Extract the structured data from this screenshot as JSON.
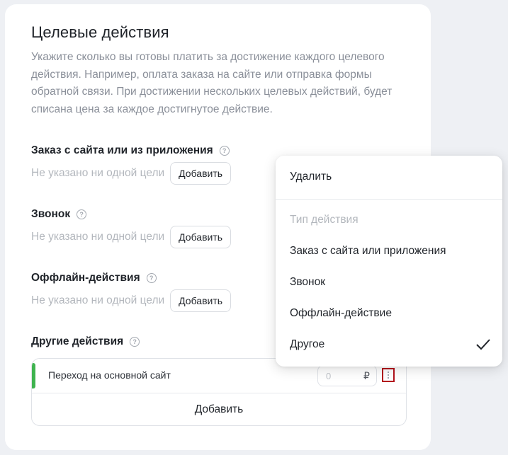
{
  "page": {
    "title": "Целевые действия",
    "description": "Укажите сколько вы готовы платить за достижение каждого целевого действия. Например, оплата заказа на сайте или отправка формы обратной связи. При достижении нескольких целевых действий, будет списана цена за каждое достигнутое действие."
  },
  "sections": [
    {
      "title": "Заказ с сайта или из приложения",
      "empty_text": "Не указано ни одной цели",
      "add_label": "Добавить"
    },
    {
      "title": "Звонок",
      "empty_text": "Не указано ни одной цели",
      "add_label": "Добавить"
    },
    {
      "title": "Оффлайн-действия",
      "empty_text": "Не указано ни одной цели",
      "add_label": "Добавить"
    },
    {
      "title": "Другие действия"
    }
  ],
  "other_goals": {
    "items": [
      {
        "name": "Переход на основной сайт",
        "price_placeholder": "0",
        "currency": "₽",
        "status_color": "#3fb34f"
      }
    ],
    "add_label": "Добавить"
  },
  "context_menu": {
    "delete_label": "Удалить",
    "type_label": "Тип действия",
    "options": [
      {
        "label": "Заказ с сайта или приложения",
        "selected": false
      },
      {
        "label": "Звонок",
        "selected": false
      },
      {
        "label": "Оффлайн-действие",
        "selected": false
      },
      {
        "label": "Другое",
        "selected": true
      }
    ]
  },
  "icons": {
    "help": "question-circle-icon",
    "menu": "kebab-menu-icon",
    "check": "checkmark-icon"
  },
  "colors": {
    "accent_green": "#3fb34f",
    "highlight_border": "#b3121c"
  }
}
